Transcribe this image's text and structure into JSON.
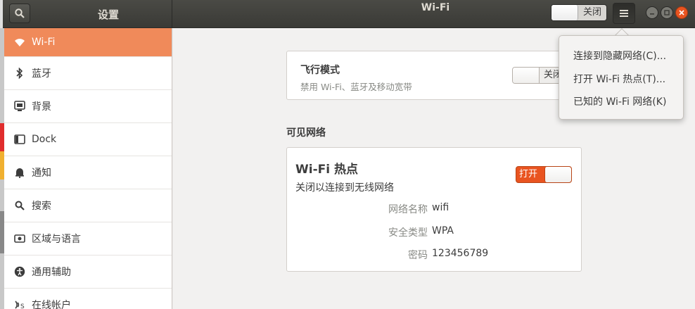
{
  "header": {
    "sidebar_title": "设置",
    "title": "Wi-Fi",
    "wifi_switch_label": "关闭"
  },
  "sidebar": {
    "items": [
      {
        "label": "Wi-Fi",
        "icon": "wifi-icon"
      },
      {
        "label": "蓝牙",
        "icon": "bluetooth-icon"
      },
      {
        "label": "背景",
        "icon": "background-icon"
      },
      {
        "label": "Dock",
        "icon": "dock-icon"
      },
      {
        "label": "通知",
        "icon": "bell-icon"
      },
      {
        "label": "搜索",
        "icon": "search-icon"
      },
      {
        "label": "区域与语言",
        "icon": "region-icon"
      },
      {
        "label": "通用辅助",
        "icon": "accessibility-icon"
      },
      {
        "label": "在线帐户",
        "icon": "online-accounts-icon"
      }
    ]
  },
  "airplane": {
    "title": "飞行模式",
    "subtitle": "禁用 Wi-Fi、蓝牙及移动宽带",
    "switch_label": "关闭"
  },
  "visible_networks_label": "可见网络",
  "hotspot": {
    "title": "Wi-Fi 热点",
    "subtitle": "关闭以连接到无线网络",
    "switch_label": "打开",
    "rows": [
      {
        "key": "网络名称",
        "value": "wifi"
      },
      {
        "key": "安全类型",
        "value": "WPA"
      },
      {
        "key": "密码",
        "value": "123456789"
      }
    ]
  },
  "menu": {
    "items": [
      {
        "label": "连接到隐藏网络(C)..."
      },
      {
        "label": "打开 Wi-Fi 热点(T)..."
      },
      {
        "label": "已知的 Wi-Fi 网络(K)"
      }
    ]
  },
  "colors": {
    "accent": "#e95420",
    "sidebar_active": "#f08a5a",
    "headerbar": "#3f3f3b"
  }
}
